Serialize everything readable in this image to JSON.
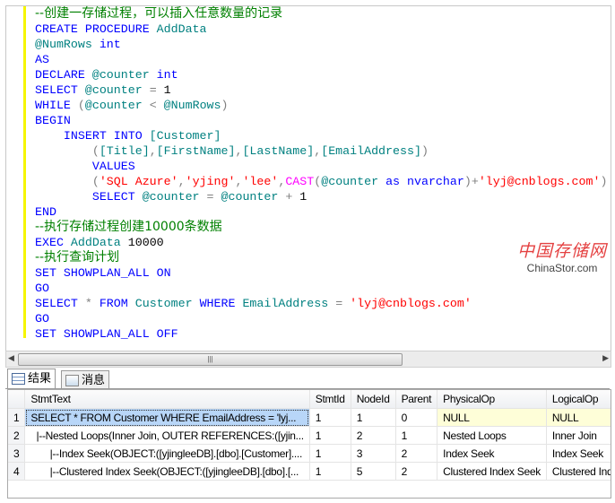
{
  "code_lines": [
    [
      [
        "--创建一存储过程，可以插入任意数量的记录",
        "c"
      ]
    ],
    [
      [
        "CREATE PROCEDURE ",
        "k"
      ],
      [
        "AddData",
        "i"
      ]
    ],
    [
      [
        "@NumRows ",
        "i"
      ],
      [
        "int",
        "k"
      ]
    ],
    [
      [
        "AS",
        "k"
      ]
    ],
    [
      [
        "DECLARE ",
        "k"
      ],
      [
        "@counter ",
        "i"
      ],
      [
        "int",
        "k"
      ]
    ],
    [
      [
        "SELECT ",
        "k"
      ],
      [
        "@counter ",
        "i"
      ],
      [
        "= ",
        "g"
      ],
      [
        "1",
        "n"
      ]
    ],
    [
      [
        "WHILE ",
        "k"
      ],
      [
        "(",
        "g"
      ],
      [
        "@counter ",
        "i"
      ],
      [
        "< ",
        "g"
      ],
      [
        "@NumRows",
        "i"
      ],
      [
        ")",
        "g"
      ]
    ],
    [
      [
        "BEGIN",
        "k"
      ]
    ],
    [
      [
        "    INSERT INTO ",
        "k"
      ],
      [
        "[Customer]",
        "i"
      ]
    ],
    [
      [
        "        (",
        "g"
      ],
      [
        "[Title]",
        "i"
      ],
      [
        ",",
        "g"
      ],
      [
        "[FirstName]",
        "i"
      ],
      [
        ",",
        "g"
      ],
      [
        "[LastName]",
        "i"
      ],
      [
        ",",
        "g"
      ],
      [
        "[EmailAddress]",
        "i"
      ],
      [
        ")",
        "g"
      ]
    ],
    [
      [
        "        VALUES",
        "k"
      ]
    ],
    [
      [
        "        (",
        "g"
      ],
      [
        "'SQL Azure'",
        "s"
      ],
      [
        ",",
        "g"
      ],
      [
        "'yjing'",
        "s"
      ],
      [
        ",",
        "g"
      ],
      [
        "'lee'",
        "s"
      ],
      [
        ",",
        "g"
      ],
      [
        "CAST",
        "f"
      ],
      [
        "(",
        "g"
      ],
      [
        "@counter ",
        "i"
      ],
      [
        "as ",
        "k"
      ],
      [
        "nvarchar",
        "k"
      ],
      [
        ")+",
        "g"
      ],
      [
        "'lyj@cnblogs.com'",
        "s"
      ],
      [
        ")",
        "g"
      ]
    ],
    [
      [
        "        SELECT ",
        "k"
      ],
      [
        "@counter ",
        "i"
      ],
      [
        "= ",
        "g"
      ],
      [
        "@counter ",
        "i"
      ],
      [
        "+ ",
        "g"
      ],
      [
        "1",
        "n"
      ]
    ],
    [
      [
        "END",
        "k"
      ]
    ],
    [
      [
        "--执行存储过程创建10000条数据",
        "c"
      ]
    ],
    [
      [
        "EXEC ",
        "k"
      ],
      [
        "AddData ",
        "i"
      ],
      [
        "10000",
        "n"
      ]
    ],
    [
      [
        "--执行查询计划",
        "c"
      ]
    ],
    [
      [
        "SET SHOWPLAN_ALL ON",
        "k"
      ]
    ],
    [
      [
        "GO",
        "k"
      ]
    ],
    [
      [
        "SELECT ",
        "k"
      ],
      [
        "* ",
        "g"
      ],
      [
        "FROM ",
        "k"
      ],
      [
        "Customer ",
        "i"
      ],
      [
        "WHERE ",
        "k"
      ],
      [
        "EmailAddress ",
        "i"
      ],
      [
        "= ",
        "g"
      ],
      [
        "'lyj@cnblogs.com'",
        "s"
      ]
    ],
    [
      [
        "GO",
        "k"
      ]
    ],
    [
      [
        "SET SHOWPLAN_ALL OFF",
        "k"
      ]
    ]
  ],
  "watermark": {
    "logo": "中国存储网",
    "site": "ChinaStor.com"
  },
  "tabs": [
    {
      "label": "结果",
      "icon": "grid-icon"
    },
    {
      "label": "消息",
      "icon": "message-icon"
    }
  ],
  "grid": {
    "columns": [
      "",
      "StmtText",
      "StmtId",
      "NodeId",
      "Parent",
      "PhysicalOp",
      "LogicalOp"
    ],
    "rows": [
      [
        "1",
        "SELECT * FROM Customer WHERE EmailAddress = 'lyj...",
        "1",
        "1",
        "0",
        "NULL",
        "NULL"
      ],
      [
        "2",
        "  |--Nested Loops(Inner Join, OUTER REFERENCES:([yjin...",
        "1",
        "2",
        "1",
        "Nested Loops",
        "Inner Join"
      ],
      [
        "3",
        "       |--Index Seek(OBJECT:([yjingleeDB].[dbo].[Customer]....",
        "1",
        "3",
        "2",
        "Index Seek",
        "Index Seek"
      ],
      [
        "4",
        "       |--Clustered Index Seek(OBJECT:([yjingleeDB].[dbo].[...",
        "1",
        "5",
        "2",
        "Clustered Index Seek",
        "Clustered Index Seek"
      ]
    ]
  }
}
